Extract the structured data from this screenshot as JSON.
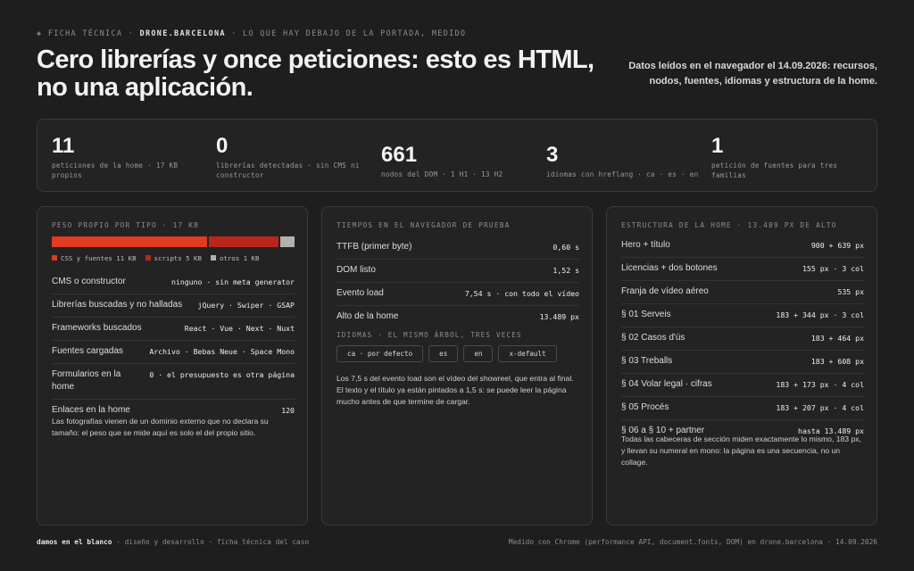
{
  "header": {
    "eyebrow_pre": "◈ FICHA TÉCNICA ·",
    "eyebrow_site": "DRONE.BARCELONA",
    "eyebrow_post": "· LO QUE HAY DEBAJO DE LA PORTADA, MEDIDO",
    "title": "Cero librerías y once peticiones: esto es HTML, no una aplicación.",
    "meta": "Datos leídos en el navegador el 14.09.2026: recursos, nodos, fuentes, idiomas y estructura de la home."
  },
  "stats": [
    {
      "num": "11",
      "label": "peticiones de la home · 17 KB propios"
    },
    {
      "num": "0",
      "label": "librerías detectadas · sin CMS ni constructor"
    },
    {
      "num": "661",
      "label": "nodos del DOM · 1 H1 · 13 H2"
    },
    {
      "num": "3",
      "label": "idiomas con hreflang · ca · es · en"
    },
    {
      "num": "1",
      "label": "petición de fuentes para tres familias"
    }
  ],
  "weight_panel": {
    "heading": "PESO PROPIO POR TIPO · 17 KB",
    "segments": [
      {
        "label": "CSS y fuentes 11 KB",
        "kb": 11,
        "color": "#e03a1f"
      },
      {
        "label": "scripts 5 KB",
        "kb": 5,
        "color": "#b8271a"
      },
      {
        "label": "otros 1 KB",
        "kb": 1,
        "color": "#b5b0aa"
      }
    ],
    "rows": [
      {
        "k": "CMS o constructor",
        "v": "ninguno · sin meta generator"
      },
      {
        "k": "Librerías buscadas y no halladas",
        "v": "jQuery · Swiper · GSAP"
      },
      {
        "k": "Frameworks buscados",
        "v": "React · Vue · Next · Nuxt"
      },
      {
        "k": "Fuentes cargadas",
        "v": "Archivo · Bebas Neue · Space Mono"
      },
      {
        "k": "Formularios en la home",
        "v": "0 · el presupuesto es otra página"
      },
      {
        "k": "Enlaces en la home",
        "v": "120"
      }
    ],
    "note": "Las fotografías vienen de un dominio externo que no declara su tamaño: el peso que se mide aquí es solo el del propio sitio."
  },
  "timing_panel": {
    "heading": "TIEMPOS EN EL NAVEGADOR DE PRUEBA",
    "rows": [
      {
        "k": "TTFB (primer byte)",
        "v": "0,60 s"
      },
      {
        "k": "DOM listo",
        "v": "1,52 s"
      },
      {
        "k": "Evento load",
        "v": "7,54 s · con todo el vídeo"
      },
      {
        "k": "Alto de la home",
        "v": "13.489 px"
      }
    ],
    "sub": "IDIOMAS · EL MISMO ÁRBOL, TRES VECES",
    "chips": [
      "ca · por defecto",
      "es",
      "en",
      "x-default"
    ],
    "note": "Los 7,5 s del evento load son el vídeo del showreel, que entra al final. El texto y el título ya están pintados a 1,5 s: se puede leer la página mucho antes de que termine de cargar."
  },
  "structure_panel": {
    "heading": "ESTRUCTURA DE LA HOME · 13.489 PX DE ALTO",
    "rows": [
      {
        "k": "Hero + título",
        "v": "900 + 639 px"
      },
      {
        "k": "Licencias + dos botones",
        "v": "155 px · 3 col"
      },
      {
        "k": "Franja de vídeo aéreo",
        "v": "535 px"
      },
      {
        "k": "§ 01 Serveis",
        "v": "183 + 344 px · 3 col"
      },
      {
        "k": "§ 02 Casos d'ús",
        "v": "183 + 464 px"
      },
      {
        "k": "§ 03 Treballs",
        "v": "183 + 608 px"
      },
      {
        "k": "§ 04 Volar legal · cifras",
        "v": "183 + 173 px · 4 col"
      },
      {
        "k": "§ 05 Procés",
        "v": "183 + 207 px · 4 col"
      },
      {
        "k": "§ 06 a § 10 + partner",
        "v": "hasta 13.489 px"
      }
    ],
    "note": "Todas las cabeceras de sección miden exactamente lo mismo, 183 px, y llevan su numeral en mono: la página es una secuencia, no un collage."
  },
  "footer": {
    "left_brand": "damos en el blanco",
    "left_rest": "· diseño y desarrollo · ficha técnica del caso",
    "right": "Medido con Chrome (performance API, document.fonts, DOM) en drone.barcelona · 14.09.2026"
  }
}
